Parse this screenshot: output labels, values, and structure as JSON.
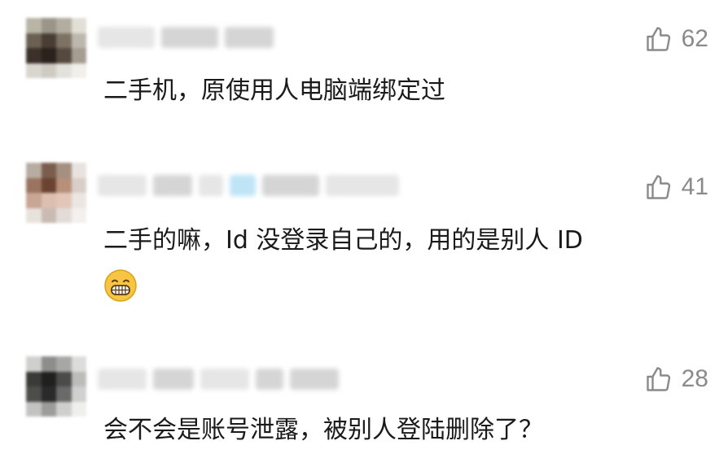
{
  "comments": [
    {
      "likes": "62",
      "text": "二手机，原使用人电脑端绑定过",
      "icon": "thumbs-up-icon"
    },
    {
      "likes": "41",
      "text": "二手的嘛，Id 没登录自己的，用的是别人 ID",
      "emoji": "grinning-face-emoji",
      "icon": "thumbs-up-icon"
    },
    {
      "likes": "28",
      "text": "会不会是账号泄露，被别人登陆删除了？",
      "icon": "thumbs-up-icon"
    }
  ],
  "colors": {
    "text": "#1a1a1a",
    "like": "#8a8a8a",
    "background": "#ffffff"
  }
}
